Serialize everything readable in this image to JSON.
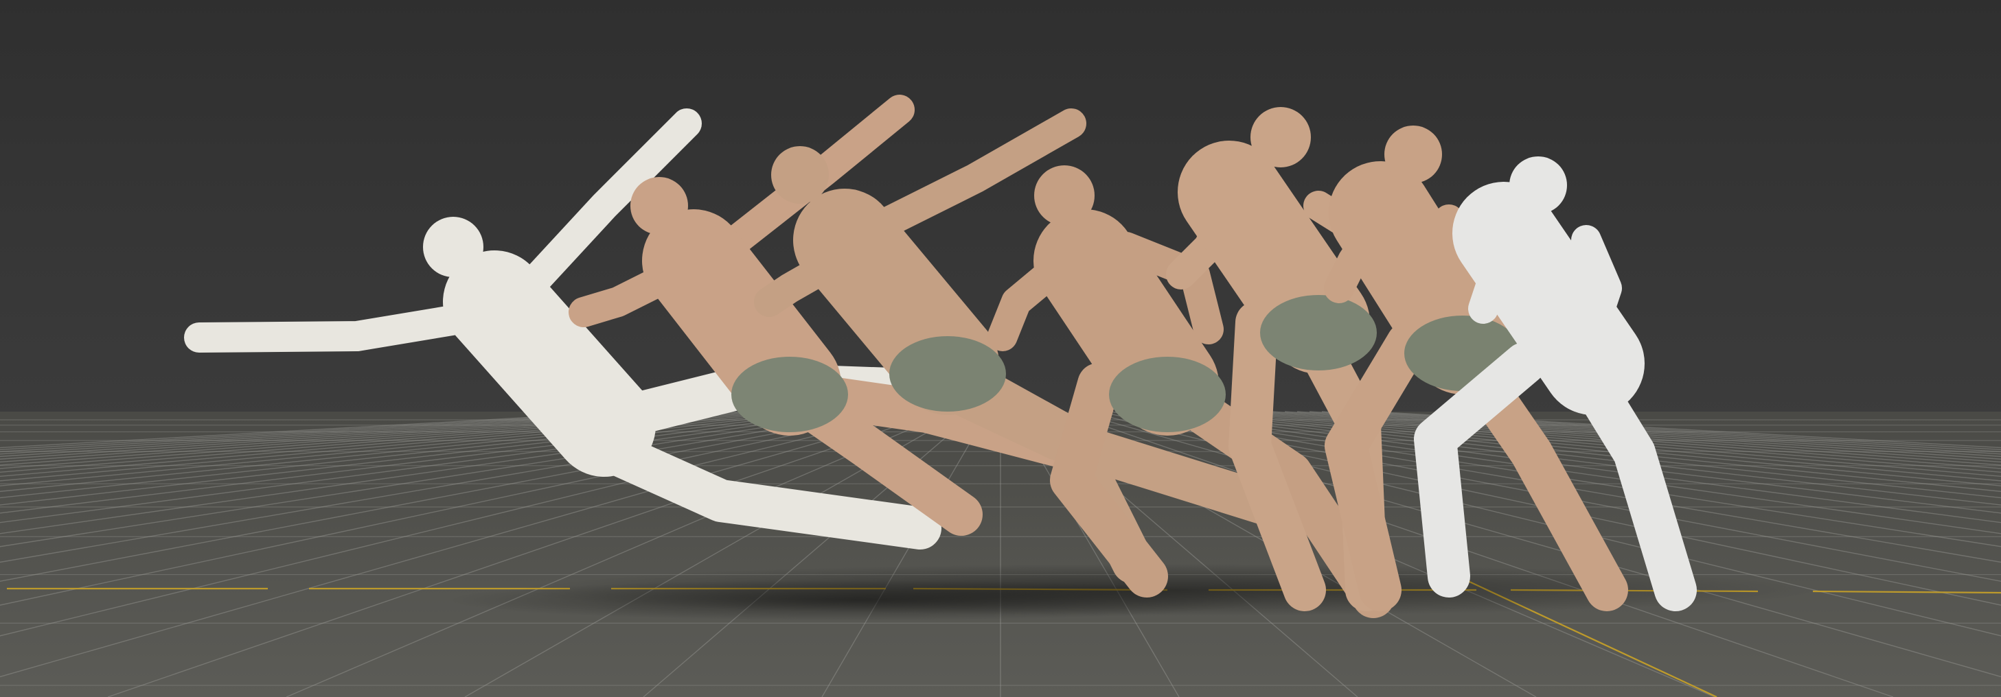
{
  "viewport": {
    "background_top": "#2f2f2f",
    "background_mid": "#3c3c3c",
    "floor_color": "#5a5a55",
    "grid_line_color": "#9a9a94",
    "axis_line_color": "#c9a227"
  },
  "figures": [
    {
      "kind": "mannequin",
      "pose": "flying-leap",
      "skin": "#e8e6df",
      "shorts": null
    },
    {
      "kind": "character",
      "pose": "leap-arm-raised",
      "skin": "#c9a287",
      "shorts": "#7d8574"
    },
    {
      "kind": "character",
      "pose": "leap-arm-raised",
      "skin": "#c4a084",
      "shorts": "#7b8372"
    },
    {
      "kind": "character",
      "pose": "landing-crouch",
      "skin": "#c59f83",
      "shorts": "#7f8675"
    },
    {
      "kind": "character",
      "pose": "upright-stride",
      "skin": "#c9a488",
      "shorts": "#7c8473"
    },
    {
      "kind": "character",
      "pose": "upright-stride",
      "skin": "#c8a286",
      "shorts": "#7a8270"
    },
    {
      "kind": "mannequin",
      "pose": "ready-stance",
      "skin": "#e6e6e4",
      "shorts": null
    }
  ]
}
